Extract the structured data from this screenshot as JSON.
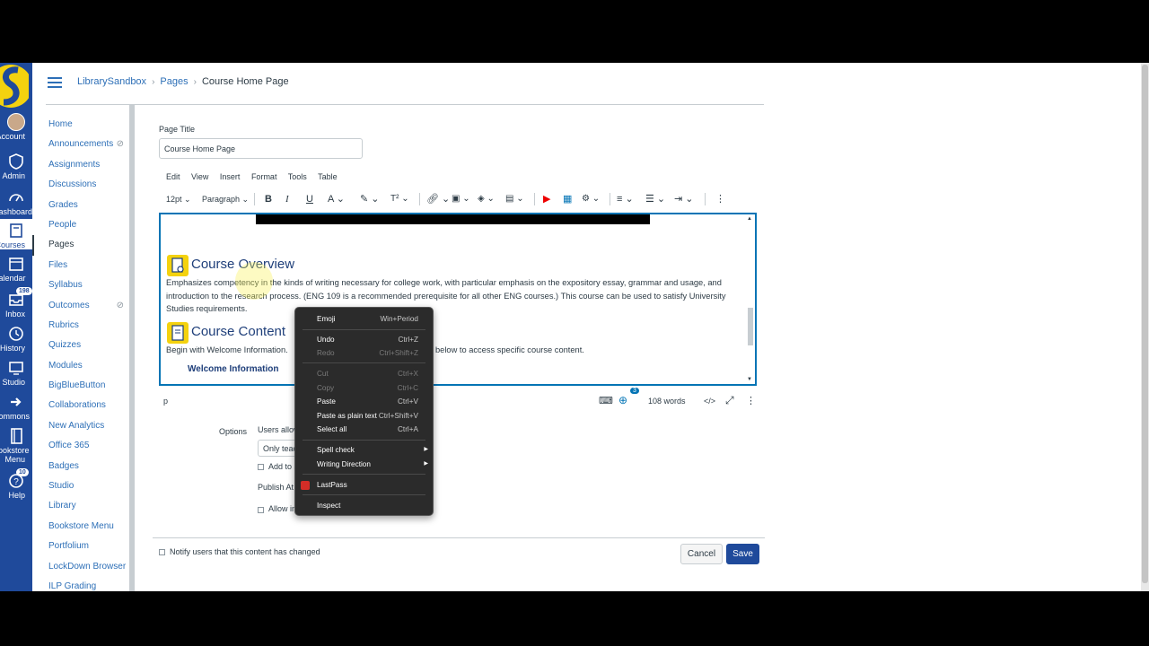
{
  "breadcrumb": {
    "course": "LibrarySandbox",
    "section": "Pages",
    "current": "Course Home Page"
  },
  "global_nav": [
    {
      "label": "Account",
      "icon": "avatar"
    },
    {
      "label": "Admin",
      "icon": "shield-icon"
    },
    {
      "label": "Dashboard",
      "icon": "dashboard-icon"
    },
    {
      "label": "Courses",
      "icon": "book-icon"
    },
    {
      "label": "Calendar",
      "icon": "calendar-icon"
    },
    {
      "label": "Inbox",
      "icon": "inbox-icon",
      "badge": "198"
    },
    {
      "label": "History",
      "icon": "clock-icon"
    },
    {
      "label": "Studio",
      "icon": "studio-icon"
    },
    {
      "label": "Commons",
      "icon": "commons-icon"
    },
    {
      "label": "Bookstore Menu",
      "icon": "bookstore-icon"
    },
    {
      "label": "Help",
      "icon": "help-icon",
      "badge": "10"
    }
  ],
  "course_nav": [
    {
      "label": "Home"
    },
    {
      "label": "Announcements",
      "hidden": true
    },
    {
      "label": "Assignments"
    },
    {
      "label": "Discussions"
    },
    {
      "label": "Grades"
    },
    {
      "label": "People"
    },
    {
      "label": "Pages",
      "active": true
    },
    {
      "label": "Files"
    },
    {
      "label": "Syllabus"
    },
    {
      "label": "Outcomes",
      "hidden": true
    },
    {
      "label": "Rubrics"
    },
    {
      "label": "Quizzes"
    },
    {
      "label": "Modules"
    },
    {
      "label": "BigBlueButton"
    },
    {
      "label": "Collaborations"
    },
    {
      "label": "New Analytics"
    },
    {
      "label": "Office 365"
    },
    {
      "label": "Badges"
    },
    {
      "label": "Studio"
    },
    {
      "label": "Library"
    },
    {
      "label": "Bookstore Menu"
    },
    {
      "label": "Portfolium"
    },
    {
      "label": "LockDown Browser"
    },
    {
      "label": "ILP Grading"
    }
  ],
  "page_title": {
    "label": "Page Title",
    "value": "Course Home Page"
  },
  "editor_menu": [
    "Edit",
    "View",
    "Insert",
    "Format",
    "Tools",
    "Table"
  ],
  "toolbar": {
    "font_size": "12pt",
    "block": "Paragraph"
  },
  "content": {
    "heading1": "Course Overview",
    "para1": "Emphasizes competency in the kinds of writing necessary for college work, with particular emphasis on the expository essay, grammar and usage, and introduction to the research process. (ENG 109 is a recommended prerequisite for all other ENG courses.) This course can be used to satisfy University Studies requirements.",
    "heading2": "Course Content",
    "para2a": "Begin with Welcome Information.",
    "para2b": "below to access specific course content.",
    "link1": "Welcome Information"
  },
  "status": {
    "element": "p",
    "word_count": "108 words",
    "a11y_badge": "3",
    "html_toggle": "</>"
  },
  "options": {
    "label": "Options",
    "users_allowed": "Users allow",
    "only_teachers": "Only teac",
    "add_to": "Add to s",
    "publish_at": "Publish At",
    "allow_in": "Allow in"
  },
  "notify": "Notify users that this content has changed",
  "buttons": {
    "cancel": "Cancel",
    "save": "Save"
  },
  "context_menu": [
    {
      "label": "Emoji",
      "key": "Win+Period"
    },
    {
      "label": "Undo",
      "key": "Ctrl+Z"
    },
    {
      "label": "Redo",
      "key": "Ctrl+Shift+Z",
      "disabled": true
    },
    {
      "label": "Cut",
      "key": "Ctrl+X",
      "disabled": true
    },
    {
      "label": "Copy",
      "key": "Ctrl+C",
      "disabled": true
    },
    {
      "label": "Paste",
      "key": "Ctrl+V"
    },
    {
      "label": "Paste as plain text",
      "key": "Ctrl+Shift+V"
    },
    {
      "label": "Select all",
      "key": "Ctrl+A"
    },
    {
      "label": "Spell check",
      "submenu": true
    },
    {
      "label": "Writing Direction",
      "submenu": true
    },
    {
      "label": "LastPass"
    },
    {
      "label": "Inspect"
    }
  ],
  "colors": {
    "brand": "#1f4a9b",
    "link": "#2d6fb7",
    "heading_icon": "#f4d20f",
    "heading_text": "#1f3f7a"
  }
}
